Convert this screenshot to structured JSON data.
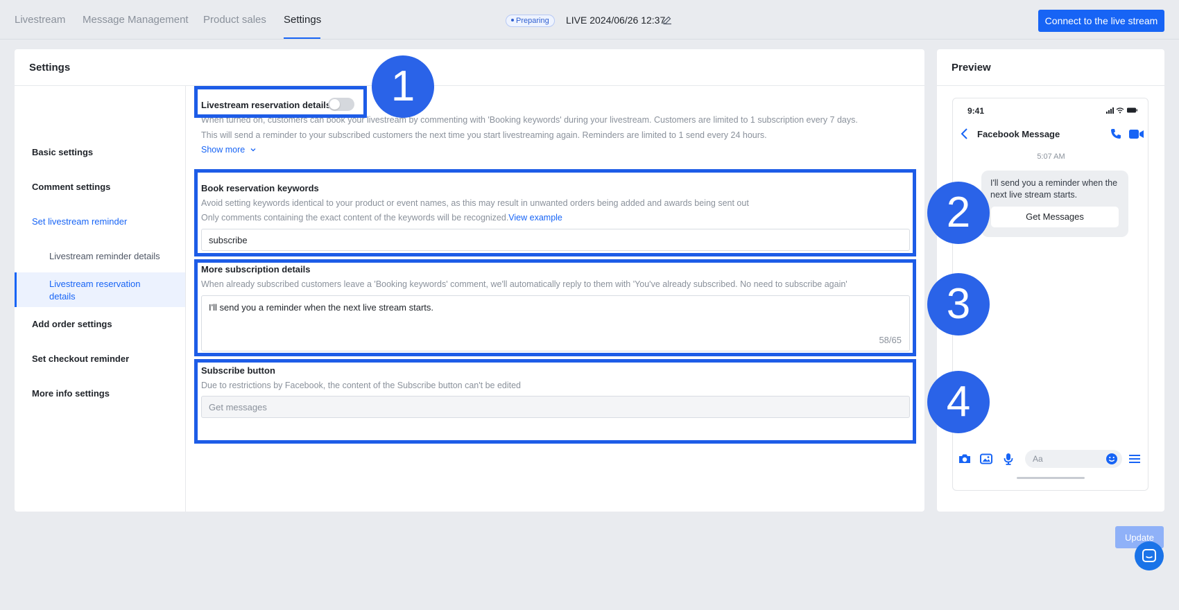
{
  "tabs": [
    {
      "label": "Livestream"
    },
    {
      "label": "Message Management"
    },
    {
      "label": "Product sales"
    },
    {
      "label": "Settings"
    }
  ],
  "status": "Preparing",
  "live_title": "LIVE 2024/06/26 12:37",
  "connect_button": "Connect to the live stream",
  "settings": {
    "title": "Settings",
    "nav": {
      "basic": "Basic settings",
      "comment": "Comment settings",
      "reminder": "Set livestream reminder",
      "reminder_details": "Livestream reminder details",
      "reservation_details": "Livestream reservation details",
      "add_order": "Add order settings",
      "checkout": "Set checkout reminder",
      "more_info": "More info settings"
    },
    "reservation": {
      "title": "Livestream reservation details",
      "enabled": false,
      "desc1": "When turned on, customers can book your livestream by commenting with 'Booking keywords' during your livestream. Customers are limited to 1 subscription every 7 days.",
      "desc2": "This will send a reminder to your subscribed customers the next time you start livestreaming again. Reminders are limited to 1 send every 24 hours.",
      "show_more": "Show more"
    },
    "keywords": {
      "title": "Book reservation keywords",
      "desc1": "Avoid setting keywords identical to your product or event names, as this may result in unwanted orders being added and awards being sent out",
      "desc2": "Only comments containing the exact content of the keywords will be recognized.",
      "view_example": "View example",
      "value": "subscribe"
    },
    "subscription": {
      "title": "More subscription details",
      "desc": "When already subscribed customers leave a 'Booking keywords' comment, we'll automatically reply to them with 'You've already subscribed. No need to subscribe again'",
      "value": "I'll send you a reminder when the next live stream starts.",
      "counter": "58/65"
    },
    "subscribe_button": {
      "title": "Subscribe button",
      "desc": "Due to restrictions by Facebook, the content of the Subscribe button can't be edited",
      "value": "Get messages"
    }
  },
  "preview": {
    "title": "Preview",
    "phone_time": "9:41",
    "header": "Facebook Message",
    "msg_time": "5:07 AM",
    "bubble_text": "I'll send you a reminder when the next live stream starts.",
    "bubble_button": "Get Messages",
    "input_placeholder": "Aa"
  },
  "annotations": [
    "1",
    "2",
    "3",
    "4"
  ],
  "update_button": "Update",
  "colors": {
    "accent": "#1764f5",
    "annotation": "#1d5ce7",
    "page_bg": "#e9ebef"
  },
  "icons": [
    "edit-icon",
    "back-icon",
    "call-icon",
    "video-icon",
    "camera-icon",
    "image-icon",
    "mic-icon",
    "emoji-icon",
    "menu-icon",
    "chevron-down-icon",
    "chat-icon"
  ]
}
